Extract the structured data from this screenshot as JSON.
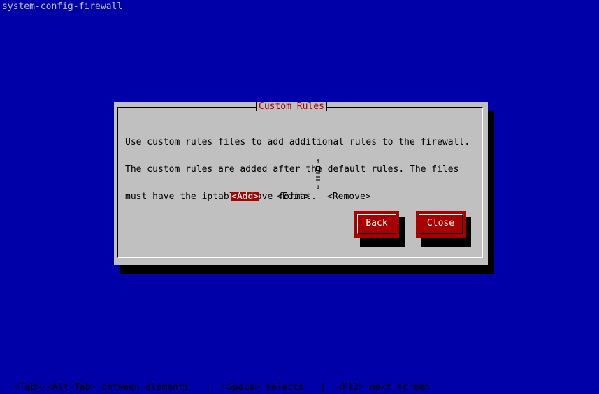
{
  "window": {
    "title": "system-config-firewall"
  },
  "dialog": {
    "title": "Custom Rules",
    "description_lines": [
      "Use custom rules files to add additional rules to the firewall.",
      "The custom rules are added after the default rules. The files",
      "must have the iptables-save format."
    ],
    "list_buttons": {
      "add": "<Add>",
      "edit": "<Edit>",
      "remove": "<Remove>"
    },
    "buttons": {
      "back": "Back",
      "close": "Close"
    }
  },
  "scrollbar": {
    "up_arrow": "↑",
    "down_arrow": "↓"
  },
  "statusbar": {
    "text": "<Tab>/<Alt-Tab> between elements   |  <Space> selects   |  <F12> next screen"
  },
  "colors": {
    "background": "#0000a8",
    "dialog": "#c0c0c0",
    "accent": "#a80000",
    "shadow": "#000000"
  }
}
